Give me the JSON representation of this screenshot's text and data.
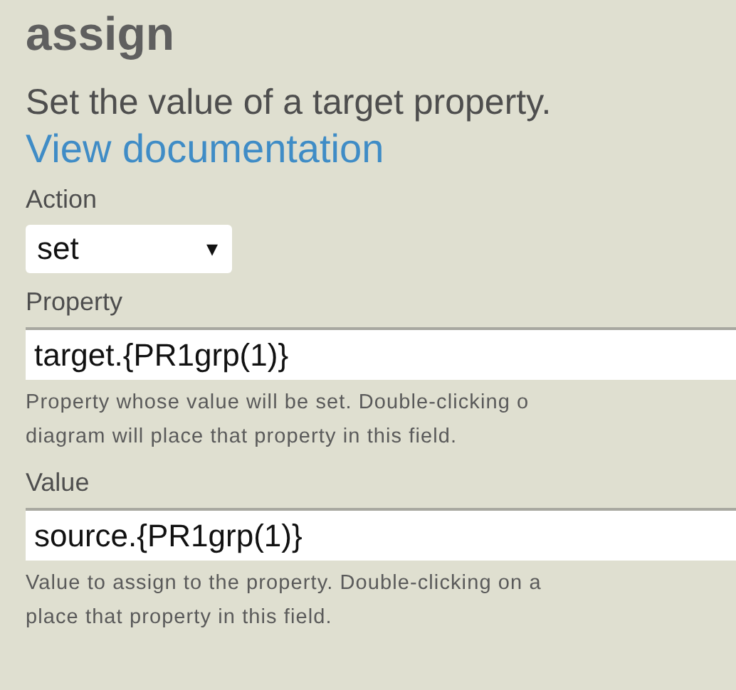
{
  "title": "assign",
  "description": "Set the value of a target property.",
  "link": "View documentation",
  "fields": [
    {
      "kind": "select",
      "label": "Action",
      "value": "set",
      "caret": "▾"
    },
    {
      "kind": "text",
      "label": "Property",
      "value": "target.{PR1grp(1)}",
      "help": [
        "Property whose value will be set. Double-clicking o",
        "diagram will place that property in this field."
      ]
    },
    {
      "kind": "text",
      "label": "Value",
      "value": "source.{PR1grp(1)}",
      "help": [
        "Value to assign to the property. Double-clicking on a",
        "place that property in this field."
      ]
    }
  ]
}
